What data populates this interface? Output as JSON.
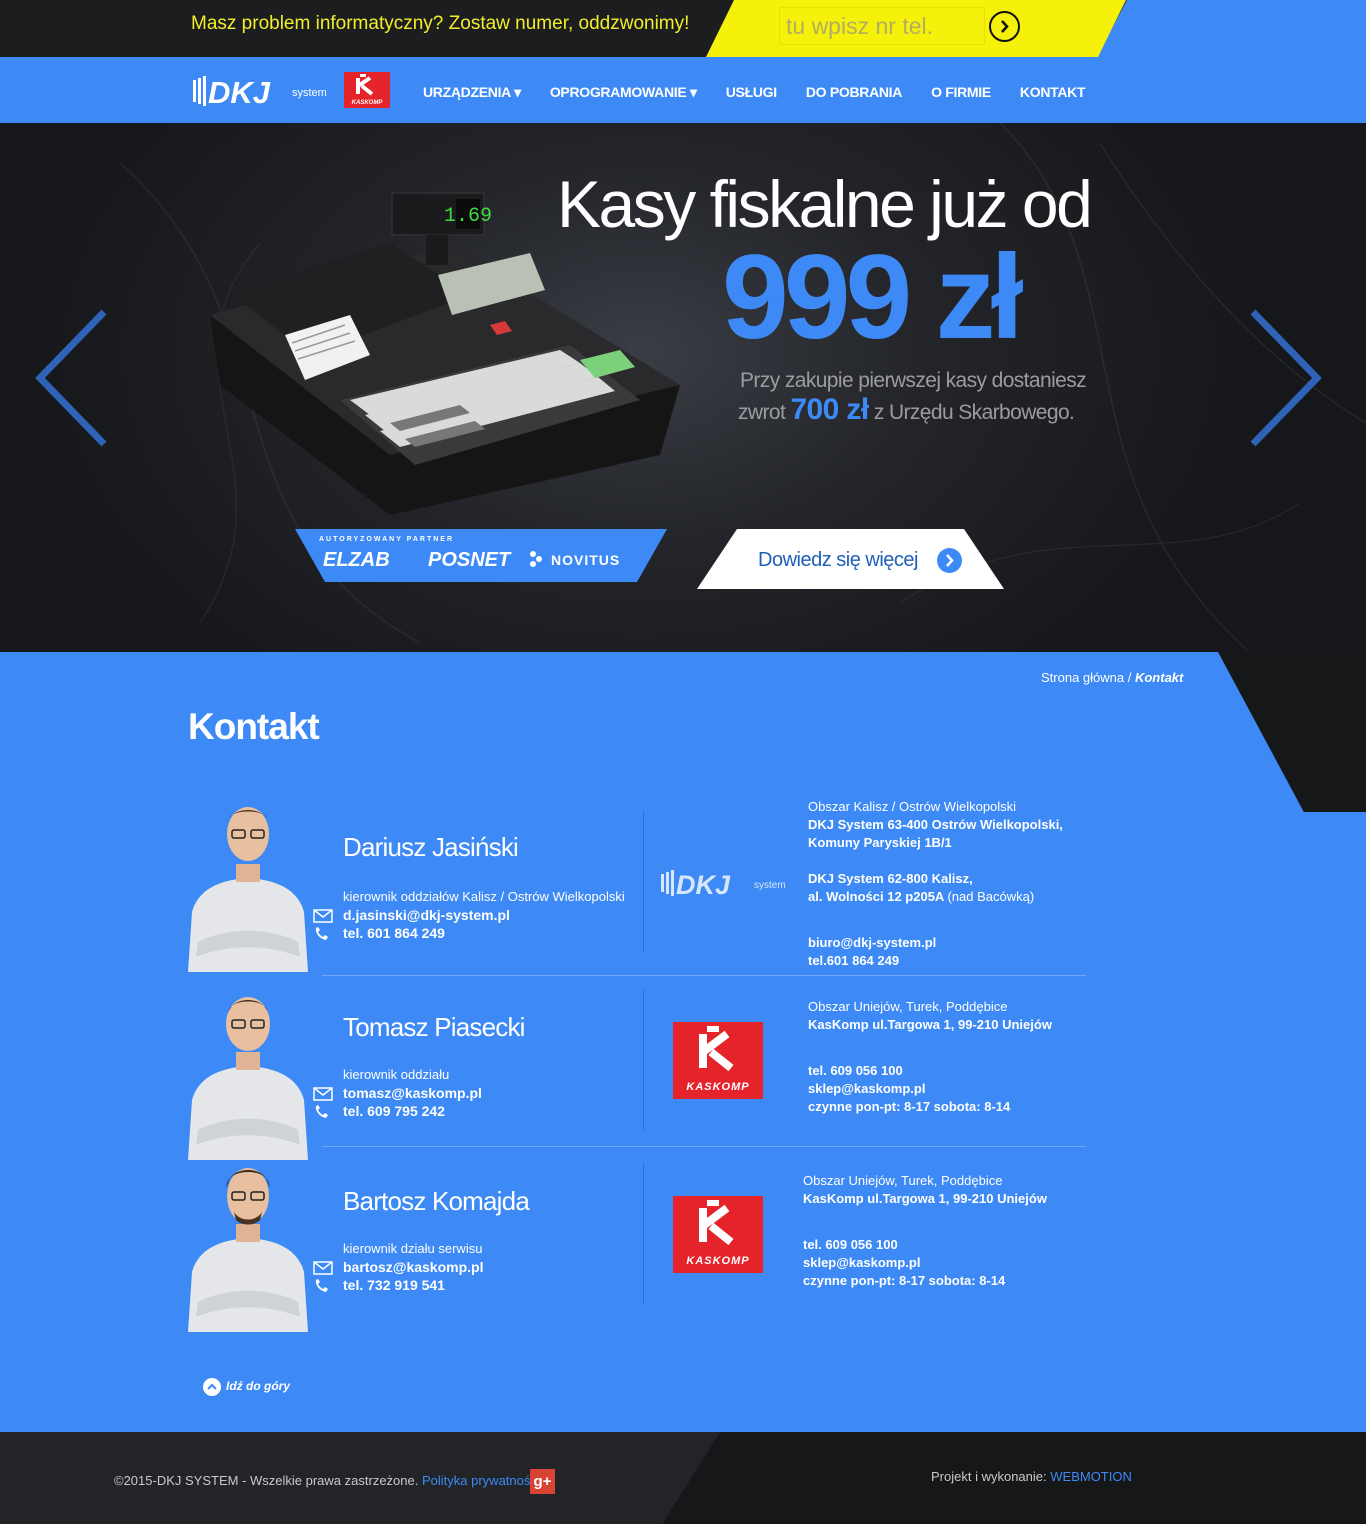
{
  "topbar": {
    "message": "Masz problem informatyczny? Zostaw numer, oddzwonimy!",
    "phone_placeholder": "tu wpisz nr tel.",
    "submit_icon": "chevron-right-circle-icon"
  },
  "nav": {
    "logo_text": "DKJ",
    "logo_suffix": "system",
    "kaskomp_logo_text": "KASKOMP",
    "items": [
      {
        "label": "URZĄDZENIA"
      },
      {
        "label": "OPROGRAMOWANIE"
      },
      {
        "label": "USŁUGI"
      },
      {
        "label": "DO POBRANIA"
      },
      {
        "label": "O FIRMIE"
      },
      {
        "label": "KONTAKT"
      }
    ],
    "dropdown_caret": "▾"
  },
  "hero": {
    "title": "Kasy fiskalne już od",
    "price": "999 zł",
    "sub1": "Przy zakupie pierwszej kasy dostaniesz",
    "sub2_pre": "zwrot",
    "sub2_amount": "700 zł",
    "sub2_post": "z Urzędu Skarbowego.",
    "display_value": "1.69",
    "partner_label": "AUTORYZOWANY PARTNER",
    "partners": [
      "ELZAB",
      "POSNET",
      "NOVITUS"
    ],
    "cta_label": "Dowiedz się więcej"
  },
  "content": {
    "breadcrumb_home": "Strona główna /",
    "breadcrumb_current": "Kontakt",
    "title": "Kontakt",
    "people": [
      {
        "name": "Dariusz Jasiński",
        "role": "kierownik oddziałów Kalisz / Ostrów Wielkopolski",
        "email": "d.jasinski@dkj-system.pl",
        "phone": "tel. 601 864 249"
      },
      {
        "name": "Tomasz Piasecki",
        "role": "kierownik oddziału",
        "email": "tomasz@kaskomp.pl",
        "phone": "tel. 609 795 242"
      },
      {
        "name": "Bartosz Komajda",
        "role": "kierownik działu serwisu",
        "email": "bartosz@kaskomp.pl",
        "phone": "tel. 732 919 541"
      }
    ],
    "offices": [
      {
        "area": "Obszar Kalisz / Ostrów Wielkopolski",
        "addr1": "DKJ System 63-400 Ostrów Wielkopolski,",
        "addr2": "Komuny Paryskiej 1B/1",
        "addr3": "DKJ System 62-800 Kalisz,",
        "addr4": "al. Wolności 12 p205A",
        "addr4_note": "(nad Bacówką)",
        "email": "biuro@dkj-system.pl",
        "phone": "tel.601 864 249"
      },
      {
        "area": "Obszar Uniejów, Turek, Poddębice",
        "addr1": "KasKomp ul.Targowa 1, 99-210 Uniejów",
        "phone": "tel. 609 056 100",
        "email": "sklep@kaskomp.pl",
        "hours": "czynne pon-pt: 8-17 sobota: 8-14"
      },
      {
        "area": "Obszar Uniejów, Turek, Poddębice",
        "addr1": "KasKomp ul.Targowa 1, 99-210 Uniejów",
        "phone": "tel. 609 056 100",
        "email": "sklep@kaskomp.pl",
        "hours": "czynne pon-pt: 8-17 sobota: 8-14"
      }
    ],
    "back_to_top": "Idź do góry"
  },
  "footer": {
    "copyright": "©2015-DKJ SYSTEM - Wszelkie prawa zastrzeżone.",
    "privacy": "Polityka prywatności",
    "gplus": "g+",
    "credit_label": "Projekt i wykonanie:",
    "credit_link": "WEBMOTION"
  },
  "colors": {
    "accent_blue": "#3d8af6",
    "yellow": "#f5f10a",
    "kaskomp_red": "#e5232a",
    "dark": "#161719"
  }
}
